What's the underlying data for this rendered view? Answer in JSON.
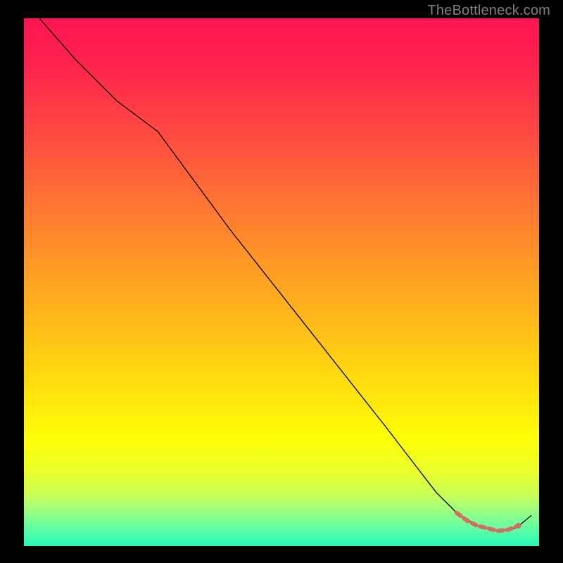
{
  "watermark": "TheBottleneck.com",
  "colors": {
    "background": "#000000",
    "watermark_text": "#7e7e7e",
    "curve": "#000000",
    "marker_fill": "#d96a5f",
    "marker_stroke": "#d96a5f",
    "gradient_top": "#ff1550",
    "gradient_bottom": "#27f8b8"
  },
  "chart_data": {
    "type": "line",
    "title": "",
    "xlabel": "",
    "ylabel": "",
    "xlim": [
      0,
      100
    ],
    "ylim": [
      0,
      100
    ],
    "legend": false,
    "curve": {
      "name": "bottleneck-curve",
      "x": [
        3,
        10,
        18,
        26,
        40,
        55,
        70,
        80,
        84,
        88,
        92,
        95.5,
        98.5
      ],
      "y": [
        100,
        92,
        84,
        78,
        59,
        40,
        21,
        8,
        4,
        1.5,
        0.5,
        1.0,
        3.5
      ]
    },
    "markers": {
      "name": "highlight-segment",
      "x": [
        84,
        86,
        88,
        90,
        92,
        94,
        96
      ],
      "y": [
        4.0,
        2.5,
        1.5,
        1.0,
        0.5,
        0.7,
        1.5
      ]
    }
  }
}
